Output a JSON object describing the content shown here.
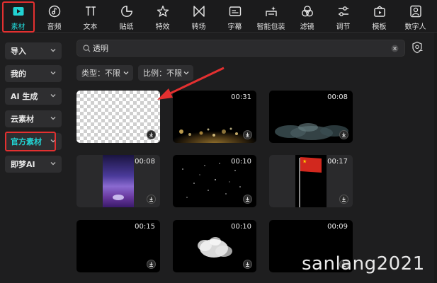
{
  "toolbar": {
    "items": [
      {
        "label": "素材",
        "icon": "media-play-icon",
        "active": true
      },
      {
        "label": "音频",
        "icon": "music-note-icon"
      },
      {
        "label": "文本",
        "icon": "text-icon"
      },
      {
        "label": "贴纸",
        "icon": "sticker-icon"
      },
      {
        "label": "特效",
        "icon": "sparkle-star-icon"
      },
      {
        "label": "转场",
        "icon": "transition-icon"
      },
      {
        "label": "字幕",
        "icon": "subtitle-icon"
      },
      {
        "label": "智能包装",
        "icon": "smart-pack-icon"
      },
      {
        "label": "滤镜",
        "icon": "filter-icon"
      },
      {
        "label": "调节",
        "icon": "adjust-sliders-icon"
      },
      {
        "label": "模板",
        "icon": "template-icon"
      },
      {
        "label": "数字人",
        "icon": "digital-human-icon"
      }
    ]
  },
  "sidebar": {
    "items": [
      {
        "label": "导入"
      },
      {
        "label": "我的"
      },
      {
        "label": "AI 生成"
      },
      {
        "label": "云素材"
      },
      {
        "label": "官方素材",
        "active": true
      },
      {
        "label": "即梦AI"
      }
    ]
  },
  "search": {
    "value": "透明"
  },
  "filters": {
    "type_label": "类型：不限",
    "ratio_label": "比例：不限"
  },
  "grid": {
    "items": [
      {
        "duration": "",
        "kind": "transparent"
      },
      {
        "duration": "00:31",
        "kind": "gold-bokeh"
      },
      {
        "duration": "00:08",
        "kind": "smoke"
      },
      {
        "duration": "00:08",
        "kind": "purple-night"
      },
      {
        "duration": "00:10",
        "kind": "particles"
      },
      {
        "duration": "00:17",
        "kind": "flag"
      },
      {
        "duration": "00:15",
        "kind": "dark"
      },
      {
        "duration": "00:10",
        "kind": "white-smoke"
      },
      {
        "duration": "00:09",
        "kind": "dark"
      }
    ]
  },
  "colors": {
    "accent": "#22d3d3",
    "annotation_red": "#e33030",
    "background": "#1e1e1f"
  },
  "watermark": "sanlang2021"
}
